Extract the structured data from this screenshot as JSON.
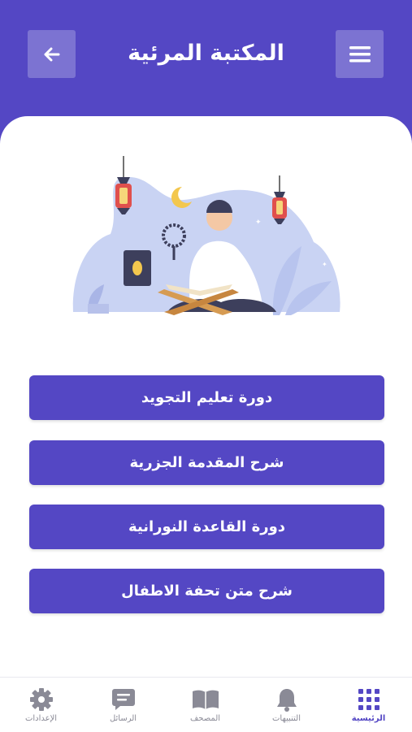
{
  "header": {
    "title": "المكتبة المرئية"
  },
  "courses": [
    {
      "label": "دورة تعليم التجويد"
    },
    {
      "label": "شرح المقدمة الجزرية"
    },
    {
      "label": "دورة القاعدة النورانية"
    },
    {
      "label": "شرح متن تحفة الاطفال"
    }
  ],
  "tabs": [
    {
      "label": "الرئيسية",
      "icon": "grid-icon",
      "active": true
    },
    {
      "label": "التنبيهات",
      "icon": "bell-icon"
    },
    {
      "label": "المصحف",
      "icon": "book-icon"
    },
    {
      "label": "الرسائل",
      "icon": "message-icon"
    },
    {
      "label": "الإعدادات",
      "icon": "gear-icon"
    }
  ],
  "colors": {
    "primary": "#5447c4",
    "tab_inactive": "#8a8a96"
  }
}
